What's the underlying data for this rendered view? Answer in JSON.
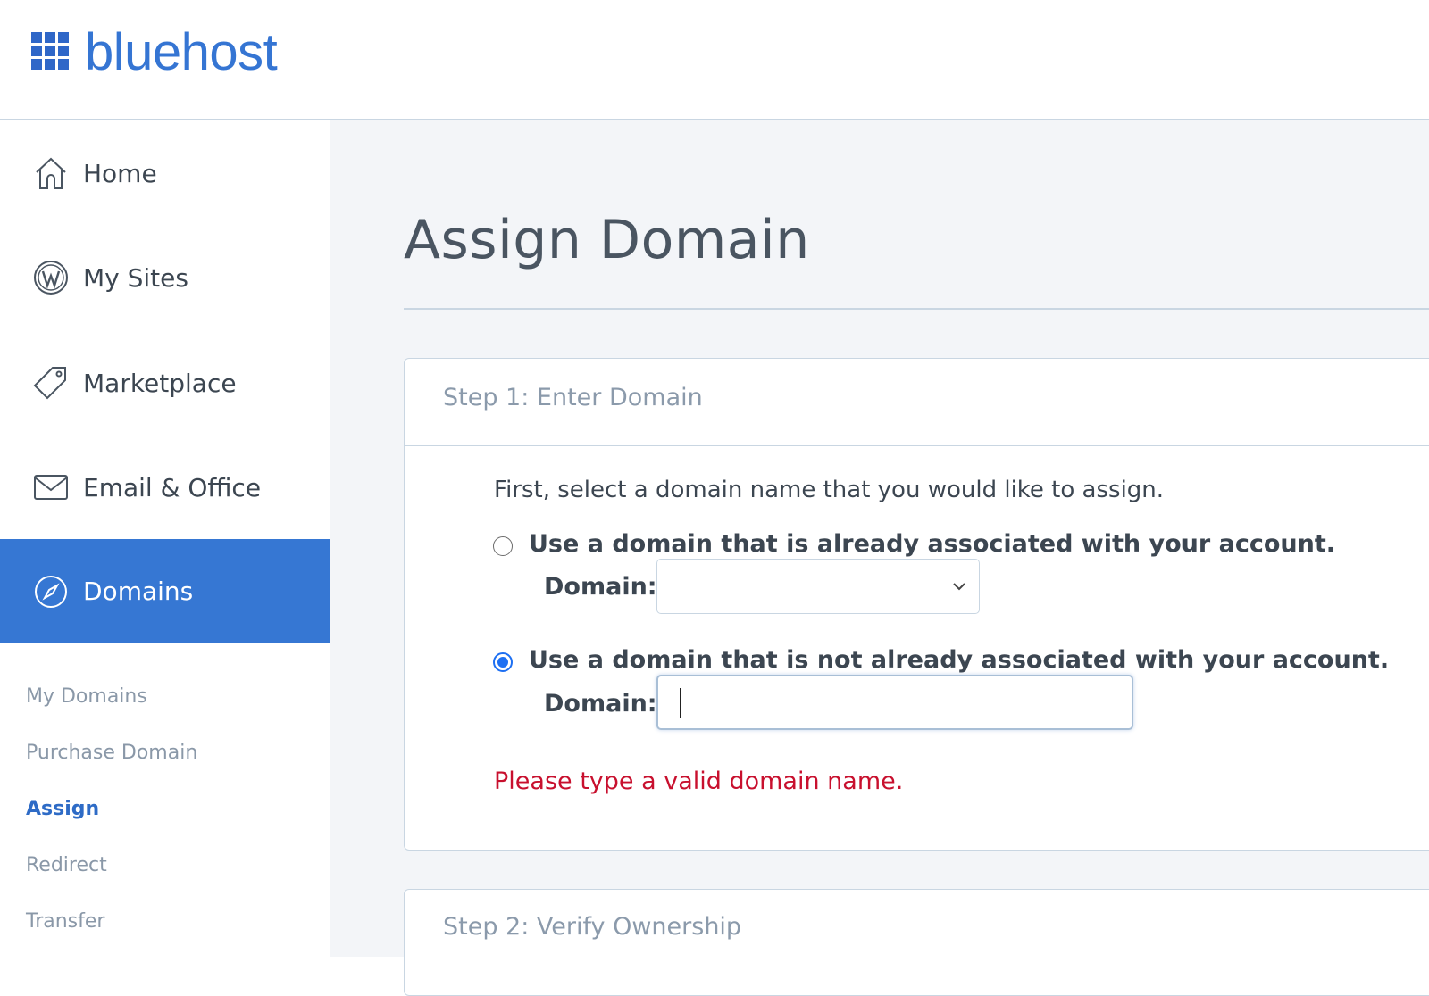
{
  "brand": {
    "name": "bluehost",
    "color": "#3575d3"
  },
  "sidebar": {
    "items": [
      {
        "label": "Home",
        "icon": "home-icon"
      },
      {
        "label": "My Sites",
        "icon": "wordpress-icon"
      },
      {
        "label": "Marketplace",
        "icon": "tag-icon"
      },
      {
        "label": "Email & Office",
        "icon": "envelope-icon"
      },
      {
        "label": "Domains",
        "icon": "compass-icon",
        "active": true
      }
    ],
    "sub_items": [
      {
        "label": "My Domains"
      },
      {
        "label": "Purchase Domain"
      },
      {
        "label": "Assign",
        "active": true
      },
      {
        "label": "Redirect"
      },
      {
        "label": "Transfer"
      }
    ],
    "active_color": "#3677d3"
  },
  "main": {
    "title": "Assign Domain",
    "step1": {
      "header": "Step 1: Enter Domain",
      "intro": "First, select a domain name that you would like to assign.",
      "option_existing": {
        "label": "Use a domain that is already associated with your account.",
        "checked": false,
        "field_label": "Domain:",
        "selected_value": ""
      },
      "option_new": {
        "label": "Use a domain that is not already associated with your account.",
        "checked": true,
        "field_label": "Domain:",
        "value": ""
      },
      "error": "Please type a valid domain name.",
      "error_color": "#c8102e"
    },
    "step2": {
      "header": "Step 2: Verify Ownership"
    }
  }
}
